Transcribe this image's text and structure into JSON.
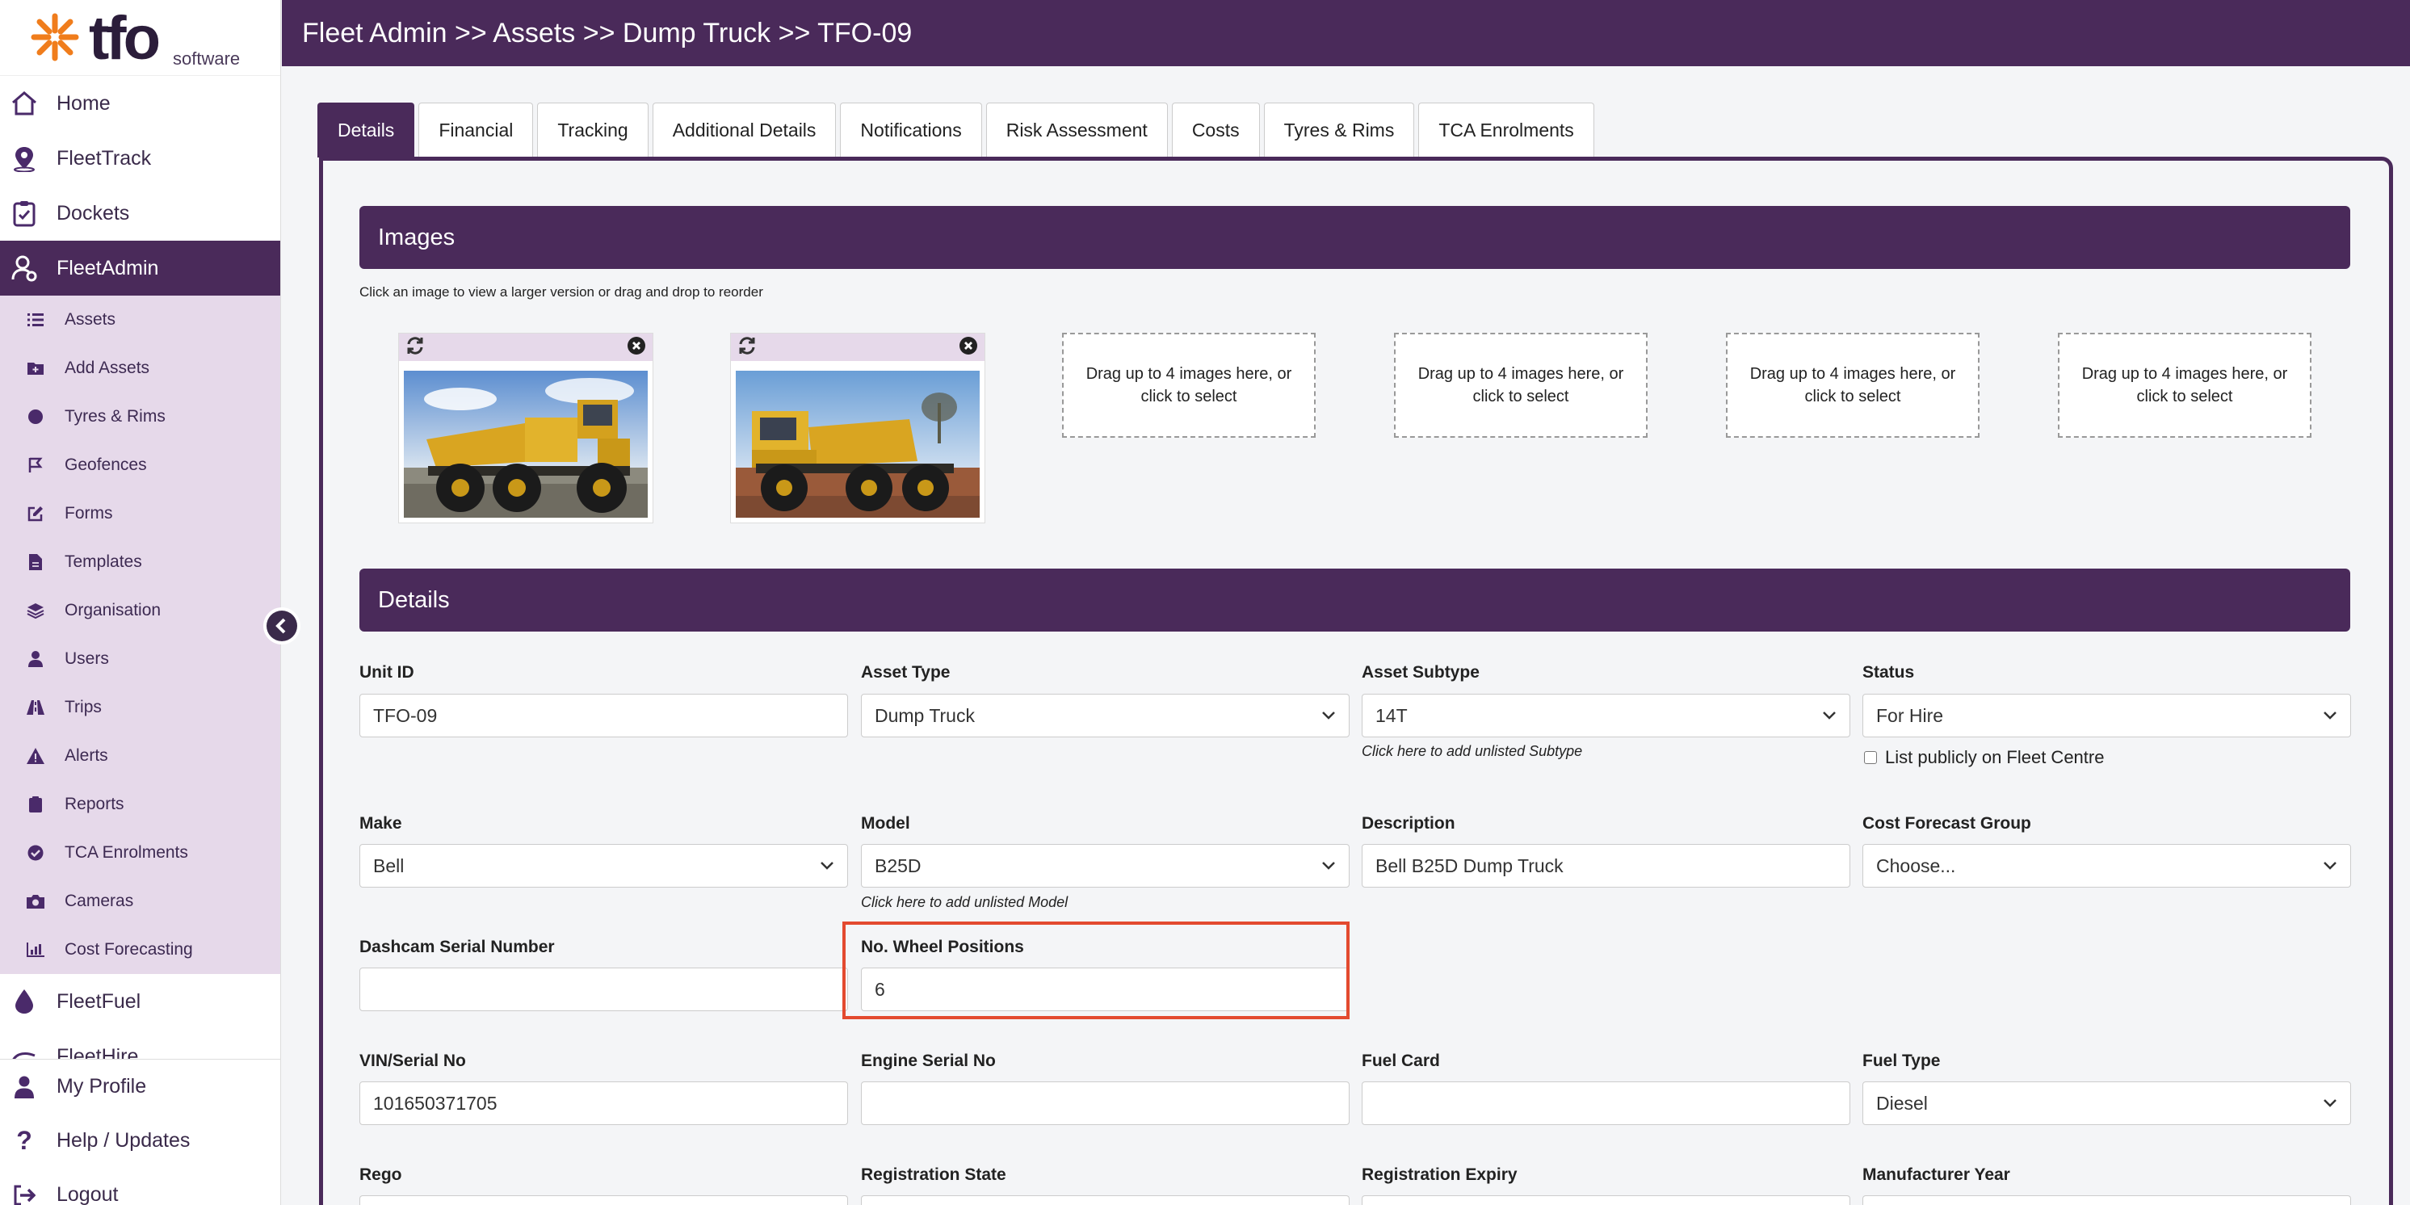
{
  "app": {
    "logo_text": "tfo",
    "logo_sub": "software",
    "breadcrumb": "Fleet Admin >> Assets >> Dump Truck >> TFO-09"
  },
  "sidebar": {
    "top_items": [
      {
        "label": "Home",
        "icon": "home-icon"
      },
      {
        "label": "FleetTrack",
        "icon": "location-pin-icon"
      },
      {
        "label": "Dockets",
        "icon": "clipboard-check-icon"
      },
      {
        "label": "FleetAdmin",
        "icon": "user-gear-icon"
      }
    ],
    "sub_items": [
      {
        "label": "Assets",
        "icon": "list-icon"
      },
      {
        "label": "Add Assets",
        "icon": "folder-plus-icon"
      },
      {
        "label": "Tyres & Rims",
        "icon": "circle-icon"
      },
      {
        "label": "Geofences",
        "icon": "flag-icon"
      },
      {
        "label": "Forms",
        "icon": "edit-icon"
      },
      {
        "label": "Templates",
        "icon": "file-icon"
      },
      {
        "label": "Organisation",
        "icon": "layers-icon"
      },
      {
        "label": "Users",
        "icon": "user-icon"
      },
      {
        "label": "Trips",
        "icon": "road-icon"
      },
      {
        "label": "Alerts",
        "icon": "warning-icon"
      },
      {
        "label": "Reports",
        "icon": "clipboard-icon"
      },
      {
        "label": "TCA Enrolments",
        "icon": "check-circle-icon"
      },
      {
        "label": "Cameras",
        "icon": "camera-icon"
      },
      {
        "label": "Cost Forecasting",
        "icon": "chart-icon"
      }
    ],
    "lower_items": [
      {
        "label": "FleetFuel",
        "icon": "fuel-drop-icon"
      },
      {
        "label": "FleetHire",
        "icon": "hire-icon"
      }
    ],
    "bottom_items": [
      {
        "label": "My Profile",
        "icon": "user-icon"
      },
      {
        "label": "Help / Updates",
        "icon": "question-icon"
      },
      {
        "label": "Logout",
        "icon": "logout-icon"
      }
    ]
  },
  "tabs": [
    "Details",
    "Financial",
    "Tracking",
    "Additional Details",
    "Notifications",
    "Risk Assessment",
    "Costs",
    "Tyres & Rims",
    "TCA Enrolments"
  ],
  "images_section": {
    "title": "Images",
    "hint": "Click an image to view a larger version or drag and drop to reorder",
    "drop_text": "Drag up to 4 images here, or click to select"
  },
  "details_section": {
    "title": "Details"
  },
  "form": {
    "unit_id": {
      "label": "Unit ID",
      "value": "TFO-09"
    },
    "asset_type": {
      "label": "Asset Type",
      "value": "Dump Truck"
    },
    "asset_subtype": {
      "label": "Asset Subtype",
      "value": "14T",
      "note": "Click here to add unlisted Subtype"
    },
    "status": {
      "label": "Status",
      "value": "For Hire",
      "checkbox": "List publicly on Fleet Centre"
    },
    "make": {
      "label": "Make",
      "value": "Bell"
    },
    "model": {
      "label": "Model",
      "value": "B25D",
      "note": "Click here to add unlisted Model"
    },
    "description": {
      "label": "Description",
      "value": "Bell B25D Dump Truck"
    },
    "cost_forecast_group": {
      "label": "Cost Forecast Group",
      "value": "Choose..."
    },
    "dashcam_serial": {
      "label": "Dashcam Serial Number",
      "value": ""
    },
    "wheel_positions": {
      "label": "No. Wheel Positions",
      "value": "6"
    },
    "vin": {
      "label": "VIN/Serial No",
      "value": "101650371705"
    },
    "engine_serial": {
      "label": "Engine Serial No",
      "value": ""
    },
    "fuel_card": {
      "label": "Fuel Card",
      "value": ""
    },
    "fuel_type": {
      "label": "Fuel Type",
      "value": "Diesel"
    },
    "rego": {
      "label": "Rego"
    },
    "registration_state": {
      "label": "Registration State"
    },
    "registration_expiry": {
      "label": "Registration Expiry"
    },
    "manufacturer_year": {
      "label": "Manufacturer Year"
    }
  },
  "colors": {
    "brand_purple": "#4a2a5a",
    "sidebar_sub_bg": "#e6d9ea",
    "highlight": "#e34a2f",
    "logo_orange": "#f07d1c"
  }
}
